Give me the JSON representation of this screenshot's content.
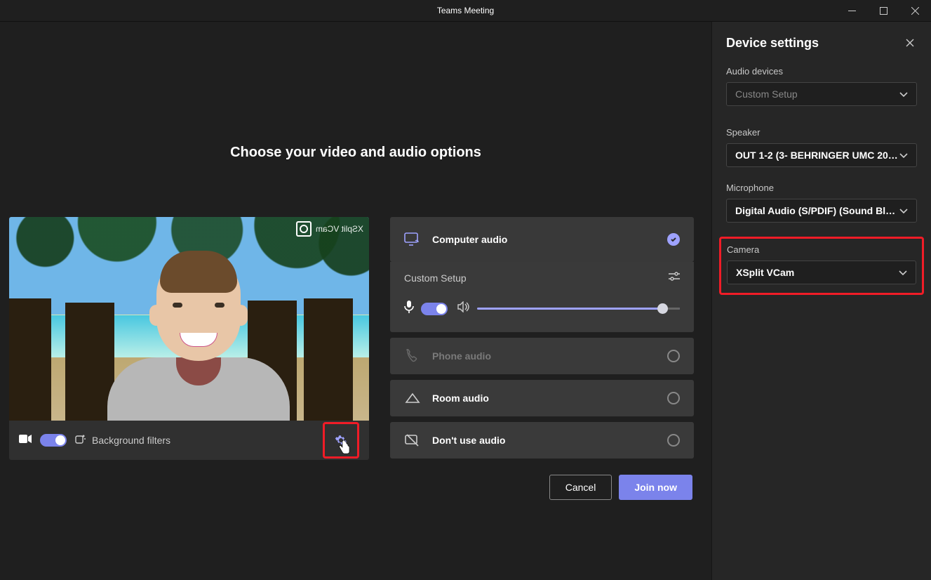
{
  "window": {
    "title": "Teams Meeting"
  },
  "main": {
    "heading": "Choose your video and audio options",
    "preview": {
      "watermark": "XSplit VCam",
      "watermark_icon": "camera-aperture-icon"
    },
    "preview_bar": {
      "camera_on": true,
      "bg_filters_label": "Background filters",
      "gear_icon": "gear-icon"
    },
    "audio_options": {
      "computer_audio": {
        "label": "Computer audio",
        "icon": "computer-audio-icon",
        "selected": true,
        "sub": {
          "setup_label": "Custom Setup",
          "settings_icon": "sliders-icon",
          "mic_on": true,
          "mic_icon": "mic-icon",
          "speaker_icon": "speaker-icon",
          "volume": 92
        }
      },
      "phone_audio": {
        "label": "Phone audio",
        "icon": "phone-icon",
        "disabled": true
      },
      "room_audio": {
        "label": "Room audio",
        "icon": "room-icon"
      },
      "no_audio": {
        "label": "Don't use audio",
        "icon": "mute-icon"
      }
    },
    "actions": {
      "cancel": "Cancel",
      "join": "Join now"
    }
  },
  "settings": {
    "title": "Device settings",
    "audio_devices_label": "Audio devices",
    "audio_devices_value": "Custom Setup",
    "speaker_label": "Speaker",
    "speaker_value": "OUT 1-2 (3- BEHRINGER UMC 20…",
    "microphone_label": "Microphone",
    "microphone_value": "Digital Audio (S/PDIF) (Sound Bl…",
    "camera_label": "Camera",
    "camera_value": "XSplit VCam"
  }
}
